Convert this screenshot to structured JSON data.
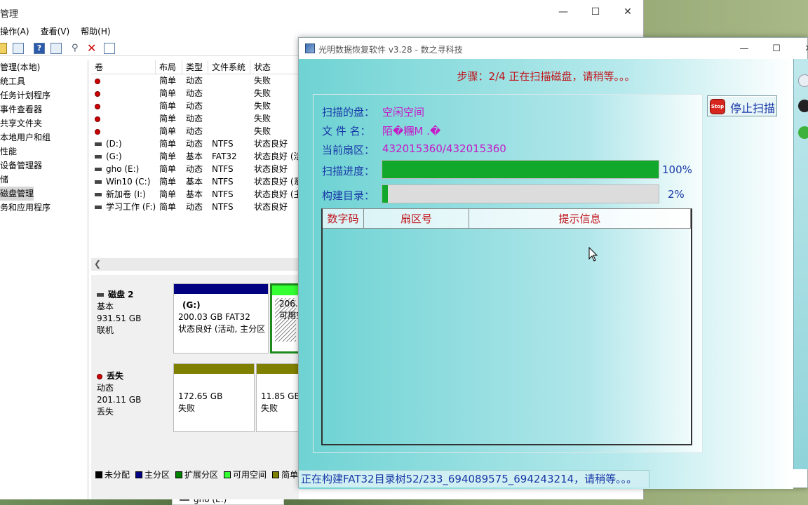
{
  "bg_window": {
    "title": "管理",
    "menu": [
      "操作(A)",
      "查看(V)",
      "帮助(H)"
    ],
    "tree": [
      "管理(本地)",
      "统工具",
      "任务计划程序",
      "事件查看器",
      "共享文件夹",
      "本地用户和组",
      "性能",
      "设备管理器",
      "储",
      "磁盘管理",
      "务和应用程序"
    ],
    "tree_selected": "磁盘管理",
    "columns": [
      "卷",
      "布局",
      "类型",
      "文件系统",
      "状态"
    ],
    "rows": [
      {
        "vol": "",
        "icon": "error",
        "layout": "简单",
        "type": "动态",
        "fs": "",
        "status": "失败"
      },
      {
        "vol": "",
        "icon": "error",
        "layout": "简单",
        "type": "动态",
        "fs": "",
        "status": "失败"
      },
      {
        "vol": "",
        "icon": "error",
        "layout": "简单",
        "type": "动态",
        "fs": "",
        "status": "失败"
      },
      {
        "vol": "",
        "icon": "error",
        "layout": "简单",
        "type": "动态",
        "fs": "",
        "status": "失败"
      },
      {
        "vol": "",
        "icon": "error",
        "layout": "简单",
        "type": "动态",
        "fs": "",
        "status": "失败"
      },
      {
        "vol": "(D:)",
        "icon": "drive",
        "layout": "简单",
        "type": "动态",
        "fs": "NTFS",
        "status": "状态良好"
      },
      {
        "vol": "(G:)",
        "icon": "drive",
        "layout": "简单",
        "type": "基本",
        "fs": "FAT32",
        "status": "状态良好 (活"
      },
      {
        "vol": "gho (E:)",
        "icon": "drive",
        "layout": "简单",
        "type": "动态",
        "fs": "NTFS",
        "status": "状态良好"
      },
      {
        "vol": "Win10 (C:)",
        "icon": "drive",
        "layout": "简单",
        "type": "基本",
        "fs": "NTFS",
        "status": "状态良好 (系"
      },
      {
        "vol": "新加卷 (I:)",
        "icon": "drive",
        "layout": "简单",
        "type": "基本",
        "fs": "NTFS",
        "status": "状态良好 (主"
      },
      {
        "vol": "学习工作 (F:)",
        "icon": "drive",
        "layout": "简单",
        "type": "动态",
        "fs": "NTFS",
        "status": "状态良好"
      }
    ],
    "disk2": {
      "name": "磁盘 2",
      "kind": "基本",
      "size": "931.51 GB",
      "state": "联机",
      "p1": {
        "name": "(G:)",
        "info": "200.03 GB FAT32",
        "status": "状态良好 (活动, 主分区"
      },
      "p2": {
        "info": "206.0",
        "status": "可用空"
      }
    },
    "lost": {
      "name": "丢失",
      "kind": "动态",
      "size": "201.11 GB",
      "state": "丢失",
      "p1": {
        "info": "172.65 GB",
        "status": "失败"
      },
      "p2": {
        "info": "11.85 GB",
        "status": "失败"
      }
    },
    "legend": [
      {
        "label": "未分配",
        "color": "#000000"
      },
      {
        "label": "主分区",
        "color": "#000080"
      },
      {
        "label": "扩展分区",
        "color": "#008000"
      },
      {
        "label": "可用空间",
        "color": "#33ff33"
      },
      {
        "label": "简单",
        "color": "#808000"
      }
    ],
    "desktop_item": "gho (E:)"
  },
  "recovery": {
    "title": "光明数据恢复软件 v3.28 - 数之寻科技",
    "step": "步骤：2/4 正在扫描磁盘，请稍等。。。",
    "scan_disk_label": "扫描的盘：",
    "scan_disk_value": "空闲空间",
    "file_name_label": "文 件 名：",
    "file_name_value": "陌�糰M .�",
    "sector_label": "当前扇区：",
    "sector_value": "432015360/432015360",
    "scan_progress_label": "扫描进度：",
    "scan_progress": 100,
    "scan_progress_text": "100%",
    "build_label": "构建目录：",
    "build_progress": 2,
    "build_progress_text": "2%",
    "table_cols": [
      "数字码",
      "扇区号",
      "提示信息"
    ],
    "stop_button": "停止扫描",
    "stop_icon_text": "Stop",
    "status": "正在构建FAT32目录树52/233_694089575_694243214，请稍等。。。"
  }
}
